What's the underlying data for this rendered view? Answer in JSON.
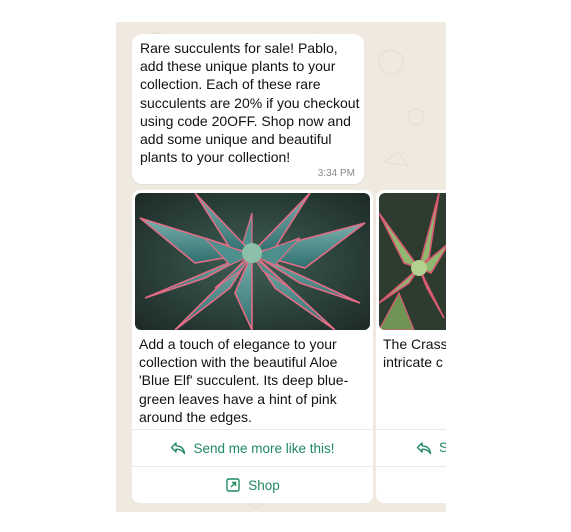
{
  "message": {
    "text": "Rare succulents for sale! Pablo, add these unique plants to your collection. Each of these rare succulents are 20% if you checkout using code 20OFF. Shop now and add some unique and beautiful plants to your collection!",
    "time": "3:34 PM"
  },
  "cards": [
    {
      "image_icon": "aloe-blue-elf-photo",
      "description": "Add a touch of elegance to your collection with the beautiful Aloe 'Blue Elf' succulent. Its deep blue-green leaves have a hint of pink around the edges.",
      "reply_label": "Send me more like this!",
      "shop_label": "Shop"
    },
    {
      "image_icon": "crassula-photo",
      "description": "The Crass sure to be with its tin intricate c",
      "reply_label": "S",
      "shop_label": ""
    }
  ],
  "colors": {
    "chat_background": "#efe9df",
    "bubble": "#ffffff",
    "action_text": "#1f8a5f",
    "timestamp": "#8a8a8a"
  }
}
